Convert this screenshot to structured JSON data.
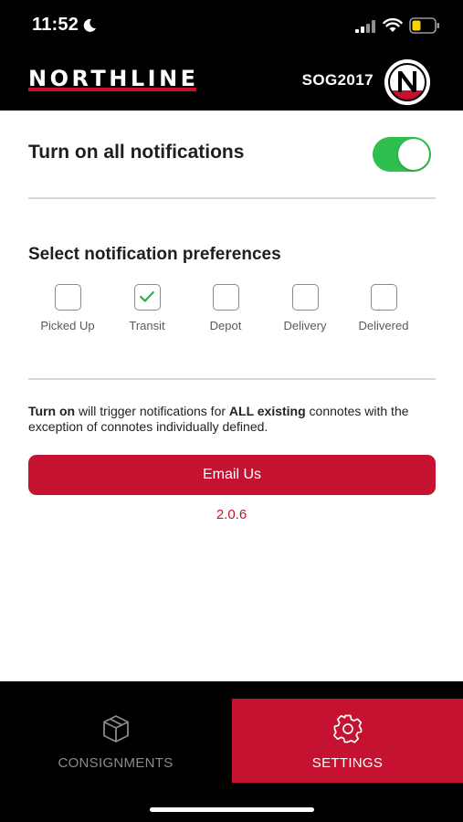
{
  "status_bar": {
    "time": "11:52",
    "battery_color": "#f5d400"
  },
  "header": {
    "brand": "NORTHLINE",
    "username": "SOG2017",
    "brand_color": "#c8102e"
  },
  "notifications": {
    "all_label": "Turn on all notifications",
    "all_enabled": true,
    "prefs_title": "Select notification preferences",
    "preferences": [
      {
        "label": "Picked Up",
        "checked": false
      },
      {
        "label": "Transit",
        "checked": true
      },
      {
        "label": "Depot",
        "checked": false
      },
      {
        "label": "Delivery",
        "checked": false
      },
      {
        "label": "Delivered",
        "checked": false
      }
    ],
    "info_bold_1": "Turn on",
    "info_text_1": " will trigger notifications for ",
    "info_bold_2": "ALL existing",
    "info_text_2": " connotes with the exception of connotes individually defined."
  },
  "actions": {
    "email_label": "Email Us",
    "version": "2.0.6"
  },
  "bottom_nav": {
    "items": [
      {
        "label": "CONSIGNMENTS",
        "icon": "box-icon",
        "active": false
      },
      {
        "label": "SETTINGS",
        "icon": "gear-icon",
        "active": true
      }
    ]
  },
  "colors": {
    "accent": "#c41230",
    "toggle_on": "#2fbf4f",
    "check": "#2fa84f"
  }
}
